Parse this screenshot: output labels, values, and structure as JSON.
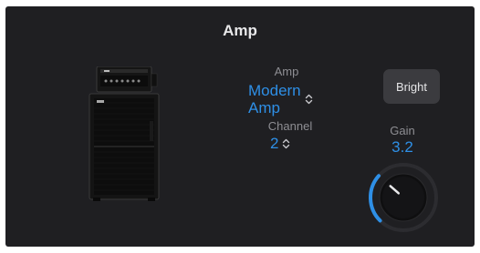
{
  "panel": {
    "title": "Amp"
  },
  "amp_selector": {
    "label": "Amp",
    "value_line1": "Modern",
    "value_line2": "Amp"
  },
  "channel_selector": {
    "label": "Channel",
    "value": "2"
  },
  "bright_button": {
    "label": "Bright"
  },
  "gain": {
    "label": "Gain",
    "value": "3.2",
    "normalized_level": 0.32
  },
  "icons": {
    "selector_arrows": "chevron-up-down-icon",
    "amp_image": "amp-stack-icon"
  },
  "colors": {
    "panel_bg": "#1f1f22",
    "accent": "#2e8fe6",
    "label_gray": "#8e8e93",
    "button_bg": "#3b3b3f"
  }
}
